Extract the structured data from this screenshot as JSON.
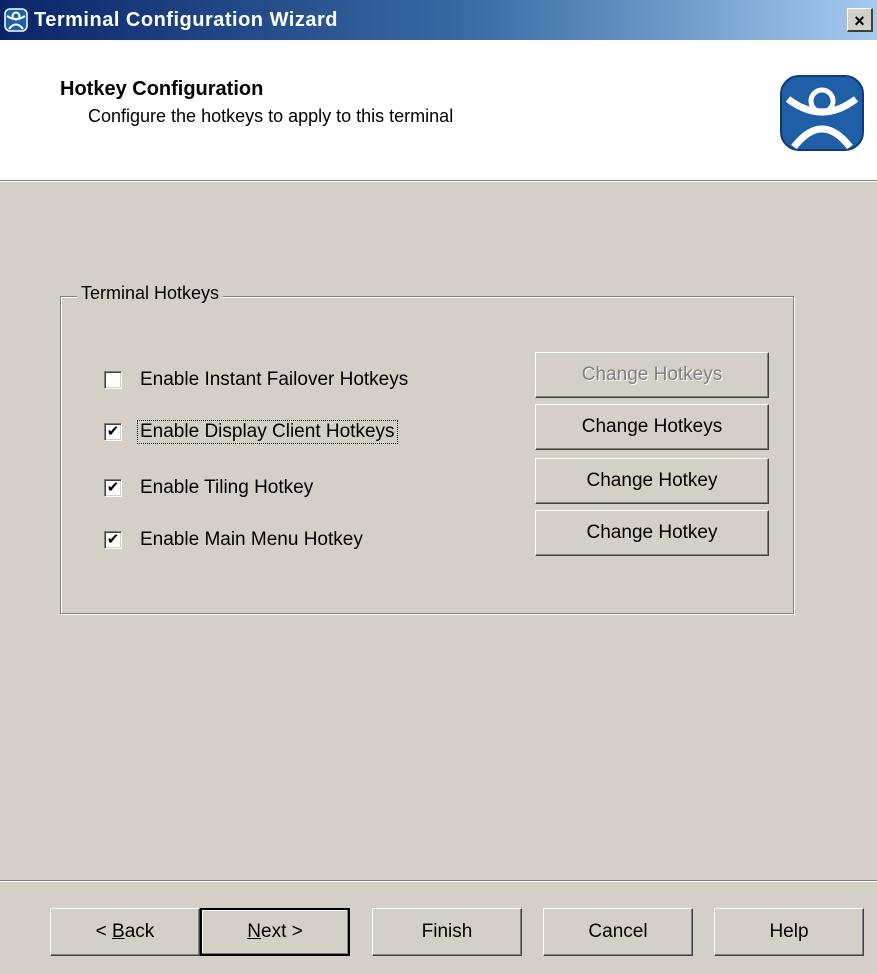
{
  "window": {
    "title": "Terminal Configuration Wizard",
    "close_label": "×"
  },
  "header": {
    "title": "Hotkey Configuration",
    "subtitle": "Configure the hotkeys to apply to this terminal"
  },
  "group": {
    "legend": "Terminal Hotkeys",
    "rows": [
      {
        "label": "Enable Instant Failover Hotkeys",
        "checked": false,
        "button": "Change Hotkeys",
        "button_enabled": false
      },
      {
        "label": "Enable Display Client Hotkeys",
        "checked": true,
        "button": "Change Hotkeys",
        "button_enabled": true,
        "focused": true
      },
      {
        "label": "Enable Tiling Hotkey",
        "checked": true,
        "button": "Change Hotkey",
        "button_enabled": true
      },
      {
        "label": "Enable Main Menu Hotkey",
        "checked": true,
        "button": "Change Hotkey",
        "button_enabled": true
      }
    ]
  },
  "nav": {
    "back_prefix": "< ",
    "back_accel": "B",
    "back_rest": "ack",
    "next_accel": "N",
    "next_rest": "ext >",
    "finish": "Finish",
    "cancel": "Cancel",
    "help": "Help"
  },
  "icons": {
    "app": "thinmanager-logo-icon",
    "logo": "thinmanager-logo-icon"
  },
  "colors": {
    "titlebar_start": "#0a246a",
    "titlebar_end": "#a6caf0",
    "logo_blue": "#1f5fa8",
    "face": "#d4d0c8"
  }
}
